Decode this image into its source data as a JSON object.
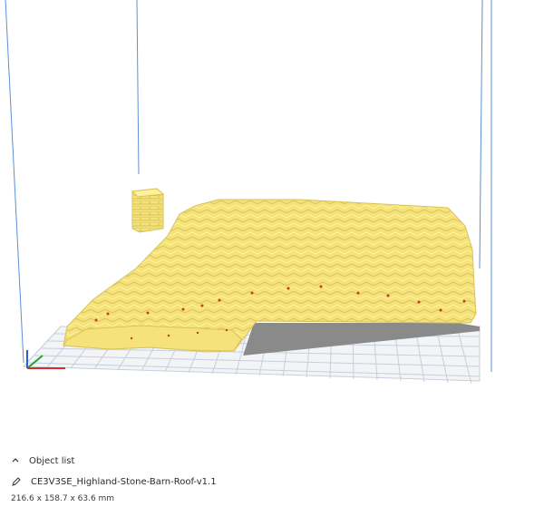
{
  "viewport": {
    "colors": {
      "build_volume_line": "#5b8fd6",
      "grid_line": "#c7cfdc",
      "plate_fill": "#f3f4f6",
      "model_fill": "#f6e27a",
      "model_highlight": "#fff29a",
      "model_shade": "#d7c35a",
      "support_shadow": "#8a8a8a",
      "model_red": "#c23b23",
      "axis_x": "#d92b2b",
      "axis_y": "#2a9f2a",
      "axis_z": "#2f5fd8"
    }
  },
  "object_list": {
    "label": "Object list",
    "collapse_icon": "chevron-up-icon",
    "items": [
      {
        "edit_icon": "pencil-icon",
        "name": "CE3V3SE_Highland-Stone-Barn-Roof-v1.1"
      }
    ]
  },
  "status": {
    "dimensions": "216.6 x 158.7 x 63.6 mm"
  }
}
